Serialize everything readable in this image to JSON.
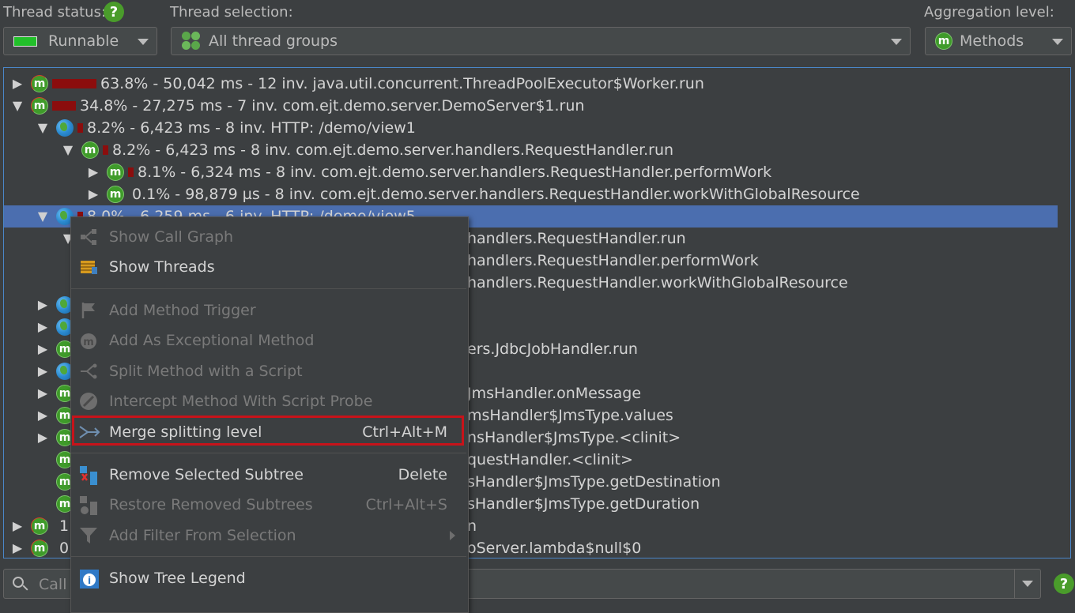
{
  "toolbar": {
    "thread_status_label": "Thread status:",
    "thread_status_value": "Runnable",
    "thread_selection_label": "Thread selection:",
    "thread_selection_value": "All thread groups",
    "aggregation_label": "Aggregation level:",
    "aggregation_value": "Methods",
    "help_glyph": "?",
    "status_color": "#22c02a"
  },
  "tree": {
    "rows": [
      {
        "text": "63.8% - 50,042 ms - 12 inv. java.util.concurrent.ThreadPoolExecutor$Worker.run",
        "icon": "method-icon",
        "expanded": false,
        "share": 0.638
      },
      {
        "text": "34.8% - 27,275 ms - 7 inv. com.ejt.demo.server.DemoServer$1.run",
        "icon": "method-icon",
        "expanded": true,
        "share": 0.348
      },
      {
        "text": "8.2% - 6,423 ms - 8 inv. HTTP: /demo/view1",
        "icon": "globe-icon",
        "expanded": true,
        "share": 0.082
      },
      {
        "text": "8.2% - 6,423 ms - 8 inv. com.ejt.demo.server.handlers.RequestHandler.run",
        "icon": "method-icon",
        "expanded": true,
        "share": 0.082
      },
      {
        "text": "8.1% - 6,324 ms - 8 inv. com.ejt.demo.server.handlers.RequestHandler.performWork",
        "icon": "method-icon",
        "expanded": false,
        "share": 0.081
      },
      {
        "text": "0.1% - 98,879 µs - 8 inv. com.ejt.demo.server.handlers.RequestHandler.workWithGlobalResource",
        "icon": "method-icon",
        "expanded": false,
        "share": 0.001
      },
      {
        "text": "8.0% - 6,259 ms - 6 inv. HTTP: /demo/view5",
        "icon": "globe-icon",
        "expanded": true,
        "share": 0.08,
        "selected": true
      },
      {
        "text": "handlers.RequestHandler.run"
      },
      {
        "text": "handlers.RequestHandler.performWork"
      },
      {
        "text": "handlers.RequestHandler.workWithGlobalResource"
      },
      {
        "text": ""
      },
      {
        "text": ""
      },
      {
        "text": "ers.JdbcJobHandler.run"
      },
      {
        "text": ""
      },
      {
        "text": "JmsHandler.onMessage"
      },
      {
        "text": "msHandler$JmsType.values"
      },
      {
        "text": "nsHandler$JmsType.<clinit>"
      },
      {
        "text": "questHandler.<clinit>"
      },
      {
        "text": "sHandler$JmsType.getDestination"
      },
      {
        "text": "sHandler$JmsType.getDuration"
      },
      {
        "text": "n"
      },
      {
        "text": "oServer.lambda$null$0"
      }
    ],
    "partial_prefix_1": "1",
    "partial_prefix_2": "0"
  },
  "context_menu": {
    "items": [
      {
        "label": "Show Call Graph",
        "shortcut": "",
        "enabled": false
      },
      {
        "label": "Show Threads",
        "shortcut": "",
        "enabled": true
      },
      {
        "label": "Add Method Trigger",
        "shortcut": "",
        "enabled": false
      },
      {
        "label": "Add As Exceptional Method",
        "shortcut": "",
        "enabled": false
      },
      {
        "label": "Split Method with a Script",
        "shortcut": "",
        "enabled": false
      },
      {
        "label": "Intercept Method With Script Probe",
        "shortcut": "",
        "enabled": false
      },
      {
        "label": "Merge splitting level",
        "shortcut": "Ctrl+Alt+M",
        "enabled": true
      },
      {
        "label": "Remove Selected Subtree",
        "shortcut": "Delete",
        "enabled": true
      },
      {
        "label": "Restore Removed Subtrees",
        "shortcut": "Ctrl+Alt+S",
        "enabled": false
      },
      {
        "label": "Add Filter From Selection",
        "shortcut": "",
        "enabled": false
      },
      {
        "label": "Show Tree Legend",
        "shortcut": "",
        "enabled": true
      }
    ],
    "highlight_color": "#c8131a"
  },
  "search": {
    "placeholder": "Call"
  }
}
